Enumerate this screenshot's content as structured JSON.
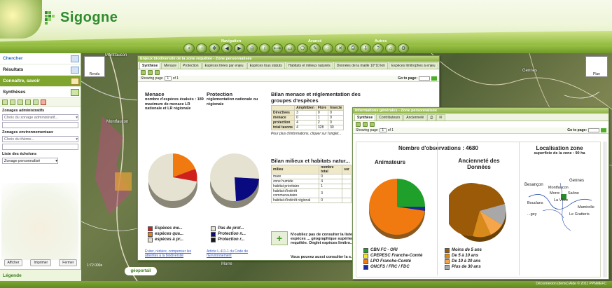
{
  "app": {
    "name": "Sigogne"
  },
  "toolbar": {
    "labels": [
      "Navigation",
      "Avancé",
      "Autres"
    ]
  },
  "left_panel": {
    "menu": [
      {
        "label": "Chercher"
      },
      {
        "label": "Résultats"
      },
      {
        "label": "Connaître, savoir"
      },
      {
        "label": "Synthèses"
      }
    ],
    "zones_admin": {
      "title": "Zonages administratifs",
      "placeholder": "Choix du zonage administratif..."
    },
    "zones_env": {
      "title": "Zonages environnementaux",
      "placeholder": "Choix du thème..."
    },
    "echelons": {
      "title": "Liste des échelons",
      "value": "Zonage personnalisé"
    },
    "buttons": [
      "Afficher",
      "Imprimer",
      "Fermer"
    ],
    "legend": "Légende"
  },
  "map": {
    "rendu": "Rendu",
    "plan": "Plan",
    "towns": [
      "Montfaucon",
      "Gennes",
      "Besançon",
      "Montfaucon",
      "Morre",
      "Saône",
      "La Vèze",
      "Mamirolle",
      "Le Gratteris",
      "Bouclans"
    ],
    "scale": "1:72 000e",
    "geoportail": "géoportail"
  },
  "footer": {
    "text": "Déconnexion (demo)   Aide   © 2011 PPNMEFC"
  },
  "window1": {
    "title": "Enjeux biodiversité de la zone requêtée - Zone personnalisée",
    "tabs": [
      "Synthèse",
      "Menace",
      "Protection",
      "Espèces triées par enjeu",
      "Espèces tous statuts",
      "Habitats et milieux naturels",
      "Données de la maille 10*10 km",
      "Espèces limitrophes à enjeu"
    ],
    "pager": {
      "showing": "Showing page",
      "page": "1",
      "of": "of",
      "total": "1",
      "goto": "Go to page:"
    },
    "menace": {
      "title": "Menace",
      "sub": "nombre d'espèces évalués : 189",
      "sub2": "maximum de menace LR nationale et LR régionale",
      "legend": [
        {
          "label": "Espèces me...",
          "color": "#d0201c"
        },
        {
          "label": "espèces qua...",
          "color": "#f07a10"
        },
        {
          "label": "espèces à pr...",
          "color": "#e5e2d2"
        }
      ],
      "link": "Éviter, réduire, compenser les atteintes à la biodiversité"
    },
    "protection": {
      "title": "Protection",
      "sub": "réglementation nationale ou régionale",
      "legend": [
        {
          "label": "Pas de prot...",
          "color": "#e5e2d2"
        },
        {
          "label": "Protection n...",
          "color": "#0a0a80"
        },
        {
          "label": "Protection r...",
          "color": "#1a1a1a"
        }
      ],
      "link": "Article L.411-1 du Code de l'Environnement"
    },
    "bilan1": {
      "title": "Bilan menace et réglementation des groupes d'espèces",
      "headers": [
        "",
        "Amphibien",
        "Flore",
        "Insecte"
      ],
      "rows": [
        [
          "Directives",
          "3",
          "0",
          "0"
        ],
        [
          "menace",
          "0",
          "1",
          "0"
        ],
        [
          "protection",
          "4",
          "2",
          "0"
        ],
        [
          "total taxons",
          "4",
          "328",
          "30"
        ]
      ],
      "note": "Pour plus d'informations, cliquer sur l'onglet..."
    },
    "bilan2": {
      "title": "Bilan milieux et habitats natur...",
      "headers": [
        "milieu",
        "nombre total",
        "sur"
      ],
      "rows": [
        [
          "mare",
          "0",
          ""
        ],
        [
          "zone humide",
          "4",
          ""
        ],
        [
          "habitat prioritaire",
          "1",
          ""
        ],
        [
          "habitat d'intérêt communautaire",
          "3",
          ""
        ],
        [
          "habitat d'intérêt régional",
          "0",
          ""
        ]
      ]
    },
    "note": "N'oubliez pas de consulter la liste des espèces ... géographique supérieure ... requêtée. Onglet espèces limitro...",
    "note2": "Vous pouvez aussi consulter la s..."
  },
  "window2": {
    "title": "Informations générales - Zone personnalisée",
    "tabs": [
      "Synthèse",
      "Contributeurs",
      "Ancienneté"
    ],
    "pager": {
      "showing": "Showing page",
      "page": "1",
      "of": "of",
      "total": "1",
      "goto": "Go to page:"
    },
    "observations": "Nombre d'observations : 4680",
    "animateurs": {
      "title": "Animateurs",
      "legend": [
        {
          "label": "CBN FC - ORI",
          "color": "#1fa02a"
        },
        {
          "label": "CPEPESC Franche-Comté",
          "color": "#f0e81c"
        },
        {
          "label": "LPO Franche-Comté",
          "color": "#f07a10"
        },
        {
          "label": "ONCFS / FRC / FDC",
          "color": "#1a2a9a"
        }
      ]
    },
    "anciennete": {
      "title": "Ancienneté des Données",
      "legend": [
        {
          "label": "Moins de 5 ans",
          "color": "#9a5a08"
        },
        {
          "label": "De 5 à 10 ans",
          "color": "#d88a1a"
        },
        {
          "label": "De 10 à 30 ans",
          "color": "#f5a64a"
        },
        {
          "label": "Plus de 30 ans",
          "color": "#a8a8a8"
        }
      ]
    },
    "localisation": {
      "title": "Localisation zone",
      "sub": "superficie de la zone : 90 ha",
      "towns": [
        "Besançon",
        "Gennes",
        "Montfaucon",
        "Morre",
        "Saône",
        "La Vèze",
        "Mamirolle",
        "Le Gratteris",
        "Bouclans",
        "...gey"
      ]
    }
  }
}
